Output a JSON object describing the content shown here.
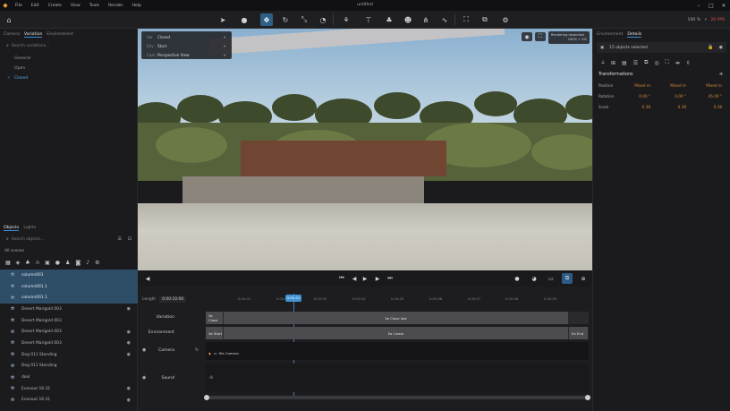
{
  "menu": {
    "items": [
      "File",
      "Edit",
      "Create",
      "View",
      "Tools",
      "Render",
      "Help"
    ],
    "window_title": "untitled"
  },
  "toolbar": {
    "zoom": "100 %",
    "fps": "20 FPS"
  },
  "left_panel": {
    "tabs": [
      "Camera",
      "Variation",
      "Environment"
    ],
    "active_tab": "Variation",
    "search_placeholder": "Search variations...",
    "variations": [
      {
        "label": "General",
        "selected": false
      },
      {
        "label": "Open",
        "selected": false
      },
      {
        "label": "Closed",
        "selected": true
      }
    ],
    "objects_tabs": [
      "Objects",
      "Lights"
    ],
    "objects_search_placeholder": "Search objects...",
    "all_scenes": "All scenes",
    "objects": [
      {
        "label": "column001",
        "selected": true,
        "eye": false
      },
      {
        "label": "column001.1",
        "selected": true,
        "eye": false
      },
      {
        "label": "column001.1",
        "selected": true,
        "eye": false
      },
      {
        "label": "Desert Marigold 003",
        "selected": false,
        "eye": true
      },
      {
        "label": "Desert Marigold 003",
        "selected": false,
        "eye": false
      },
      {
        "label": "Desert Marigold 003",
        "selected": false,
        "eye": true
      },
      {
        "label": "Desert Marigold 003",
        "selected": false,
        "eye": true
      },
      {
        "label": "Dog 011 Standing",
        "selected": false,
        "eye": true
      },
      {
        "label": "Dog 011 Standing",
        "selected": false,
        "eye": false
      },
      {
        "label": "door",
        "selected": false,
        "eye": false
      },
      {
        "label": "Evenout 16-31",
        "selected": false,
        "eye": true
      },
      {
        "label": "Evenout 16-31",
        "selected": false,
        "eye": true
      }
    ]
  },
  "viewport": {
    "overlay": [
      {
        "key": "Var",
        "value": "Closed"
      },
      {
        "key": "Env",
        "value": "Start"
      },
      {
        "key": "Cam",
        "value": "Perspective View"
      }
    ],
    "render_info": [
      "Rendering resolution",
      "100% + 4%"
    ]
  },
  "timeline": {
    "length_label": "Length",
    "length_value": "0:00:10:00",
    "playhead": "0:00:01",
    "ticks": [
      "0:00:01",
      "0:00:02",
      "0:00:03",
      "0:00:04",
      "0:00:05",
      "0:00:06",
      "0:00:07",
      "0:00:08",
      "0:00:09"
    ],
    "tracks": {
      "variation": {
        "label": "Variation",
        "start": "Va Close",
        "middle": "Va Close last",
        "end": ""
      },
      "environment": {
        "label": "Environment",
        "start": "Va Start",
        "middle": "Ea Linear",
        "end": "Ea End"
      },
      "camera": {
        "label": "Camera",
        "clip": "f0a Camera"
      },
      "sound": {
        "label": "Sound"
      }
    }
  },
  "right_panel": {
    "tabs": [
      "Environment",
      "Details"
    ],
    "active_tab": "Details",
    "selection": "15 objects selected",
    "section": "Transformations",
    "rows": [
      {
        "label": "Position",
        "x": "Mixed m",
        "y": "Mixed m",
        "z": "Mixed m"
      },
      {
        "label": "Rotation",
        "x": "0.00 °",
        "y": "0.00 °",
        "z": "45.00 °"
      },
      {
        "label": "Scale",
        "x": "0.38",
        "y": "0.38",
        "z": "0.38"
      }
    ]
  }
}
